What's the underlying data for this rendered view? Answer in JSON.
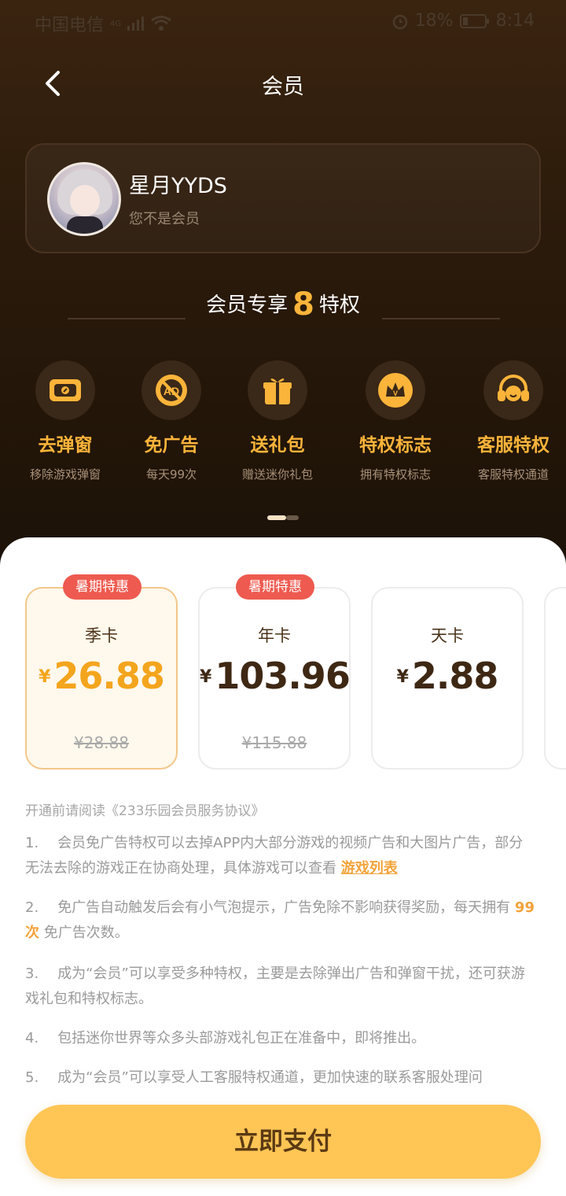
{
  "status": {
    "carrier": "中国电信",
    "signal": "4G",
    "alarm_battery": "18%",
    "time": "8:14"
  },
  "header": {
    "title": "会员"
  },
  "profile": {
    "name": "星月YYDS",
    "status": "您不是会员"
  },
  "privileges": {
    "prefix": "会员专享",
    "count": "8",
    "suffix": "特权"
  },
  "features": [
    {
      "name": "去弹窗",
      "desc": "移除游戏弹窗",
      "icon": "card-icon"
    },
    {
      "name": "免广告",
      "desc": "每天99次",
      "icon": "no-ad-icon"
    },
    {
      "name": "送礼包",
      "desc": "赠送迷你礼包",
      "icon": "gift-icon"
    },
    {
      "name": "特权标志",
      "desc": "拥有特权标志",
      "icon": "crown-icon"
    },
    {
      "name": "客服特权",
      "desc": "客服特权通道",
      "icon": "headset-icon"
    }
  ],
  "plans": [
    {
      "badge": "暑期特惠",
      "name": "季卡",
      "currency": "¥",
      "price": "26.88",
      "original": "¥28.88",
      "selected": true
    },
    {
      "badge": "暑期特惠",
      "name": "年卡",
      "currency": "¥",
      "price": "103.96",
      "original": "¥115.88",
      "selected": false
    },
    {
      "badge": "",
      "name": "天卡",
      "currency": "¥",
      "price": "2.88",
      "original": "",
      "selected": false
    }
  ],
  "agreement": "开通前请阅读《233乐园会员服务协议》",
  "rules": [
    {
      "no": "1.",
      "text": "会员免广告特权可以去掉APP内大部分游戏的视频广告和大图片广告，部分无法去除的游戏正在协商处理，具体游戏可以查看",
      "link": "游戏列表"
    },
    {
      "no": "2.",
      "text_a": "免广告自动触发后会有小气泡提示，广告免除不影响获得奖励，每天拥有",
      "highlight": "99次",
      "text_b": "免广告次数。"
    },
    {
      "no": "3.",
      "text": "成为“会员”可以享受多种特权，主要是去除弹出广告和弹窗干扰，还可获游戏礼包和特权标志。"
    },
    {
      "no": "4.",
      "text": "包括迷你世界等众多头部游戏礼包正在准备中，即将推出。"
    },
    {
      "no": "5.",
      "text": "成为“会员”可以享受人工客服特权通道，更加快速的联系客服处理问"
    }
  ],
  "pay_button": "立即支付",
  "colors": {
    "accent": "#fbb43a",
    "badge": "#ee5a4f",
    "pay": "#ffc555"
  }
}
